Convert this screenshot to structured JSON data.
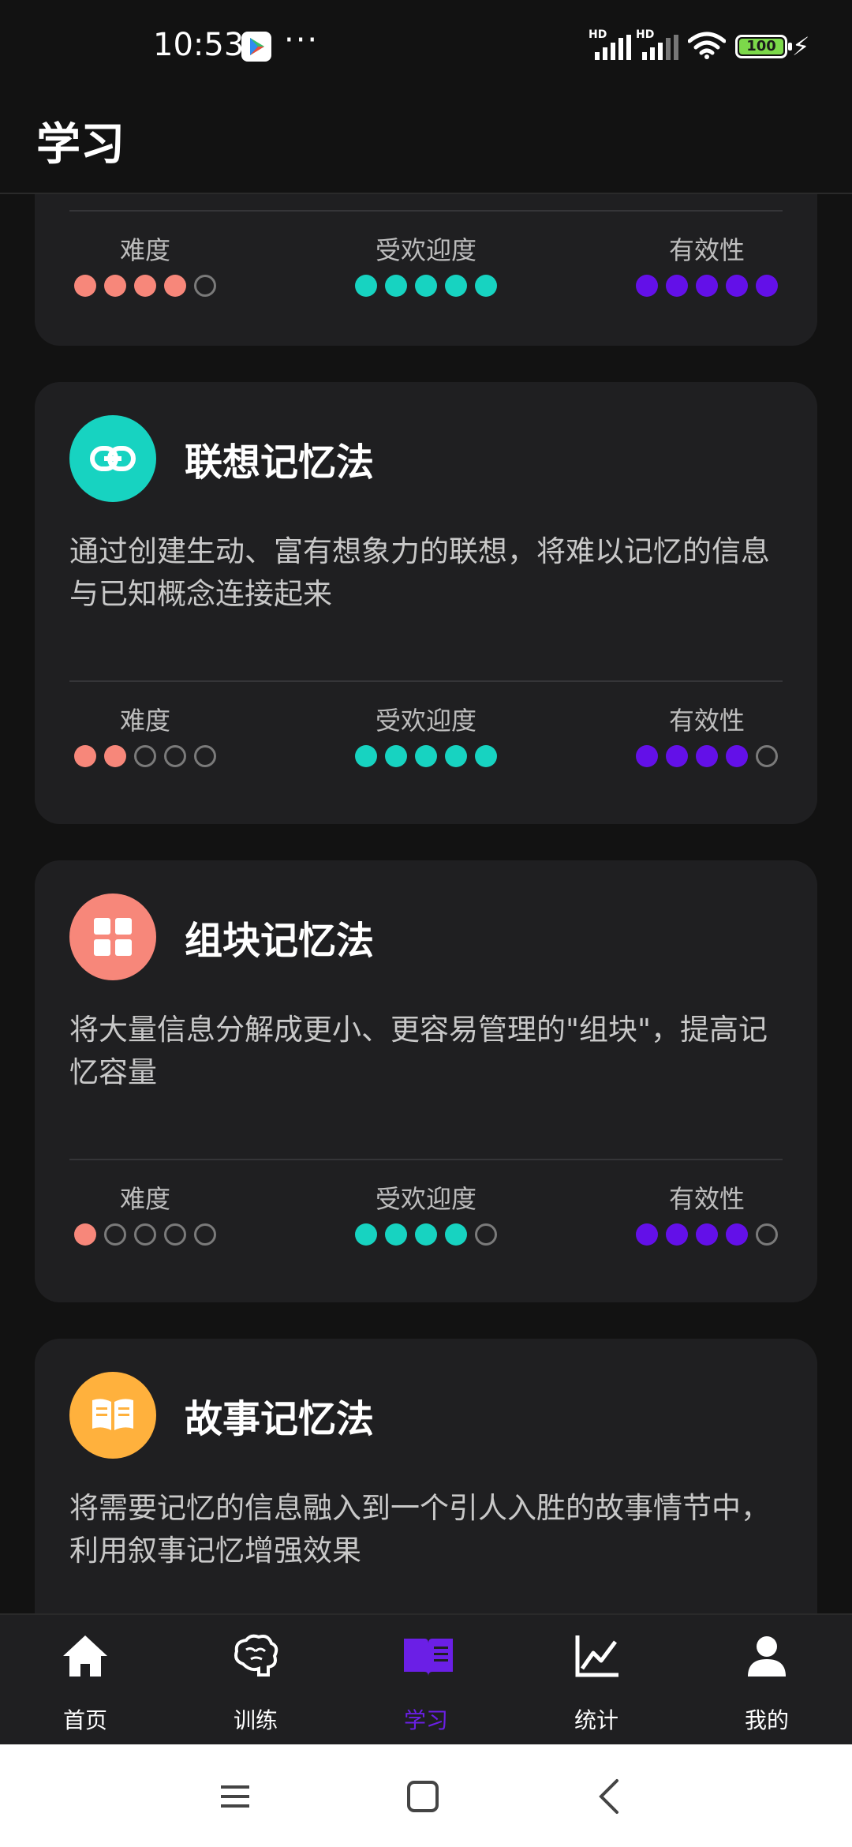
{
  "status_bar": {
    "time": "10:53",
    "more": "···",
    "signal1_label": "HD",
    "signal2_label": "HD",
    "battery": "100"
  },
  "app_bar": {
    "title": "学习"
  },
  "colors": {
    "difficulty": "#f7877a",
    "popularity": "#17d3c1",
    "effectiveness": "#6310e8",
    "active_tab": "#6b1fe6"
  },
  "top_card": {
    "metrics": [
      {
        "label": "难度",
        "filled": 4,
        "total": 5,
        "color": "#f7877a"
      },
      {
        "label": "受欢迎度",
        "filled": 5,
        "total": 5,
        "color": "#17d3c1"
      },
      {
        "label": "有效性",
        "filled": 5,
        "total": 5,
        "color": "#6310e8"
      }
    ]
  },
  "cards": [
    {
      "title": "联想记忆法",
      "description": "通过创建生动、富有想象力的联想，将难以记忆的信息与已知概念连接起来",
      "icon": "link-icon",
      "icon_color": "#17d3c1",
      "metrics": [
        {
          "label": "难度",
          "filled": 2,
          "total": 5,
          "color": "#f7877a"
        },
        {
          "label": "受欢迎度",
          "filled": 5,
          "total": 5,
          "color": "#17d3c1"
        },
        {
          "label": "有效性",
          "filled": 4,
          "total": 5,
          "color": "#6310e8"
        }
      ]
    },
    {
      "title": "组块记忆法",
      "description": "将大量信息分解成更小、更容易管理的\"组块\"，提高记忆容量",
      "icon": "grid-icon",
      "icon_color": "#f7877a",
      "metrics": [
        {
          "label": "难度",
          "filled": 1,
          "total": 5,
          "color": "#f7877a"
        },
        {
          "label": "受欢迎度",
          "filled": 4,
          "total": 5,
          "color": "#17d3c1"
        },
        {
          "label": "有效性",
          "filled": 4,
          "total": 5,
          "color": "#6310e8"
        }
      ]
    },
    {
      "title": "故事记忆法",
      "description": "将需要记忆的信息融入到一个引人入胜的故事情节中，利用叙事记忆增强效果",
      "icon": "book-icon",
      "icon_color": "#ffb13d",
      "metrics": []
    }
  ],
  "bottom_nav": {
    "items": [
      {
        "label": "首页",
        "icon": "home-icon"
      },
      {
        "label": "训练",
        "icon": "brain-icon"
      },
      {
        "label": "学习",
        "icon": "book-open-icon",
        "active": true
      },
      {
        "label": "统计",
        "icon": "chart-line-icon"
      },
      {
        "label": "我的",
        "icon": "user-icon"
      }
    ]
  }
}
